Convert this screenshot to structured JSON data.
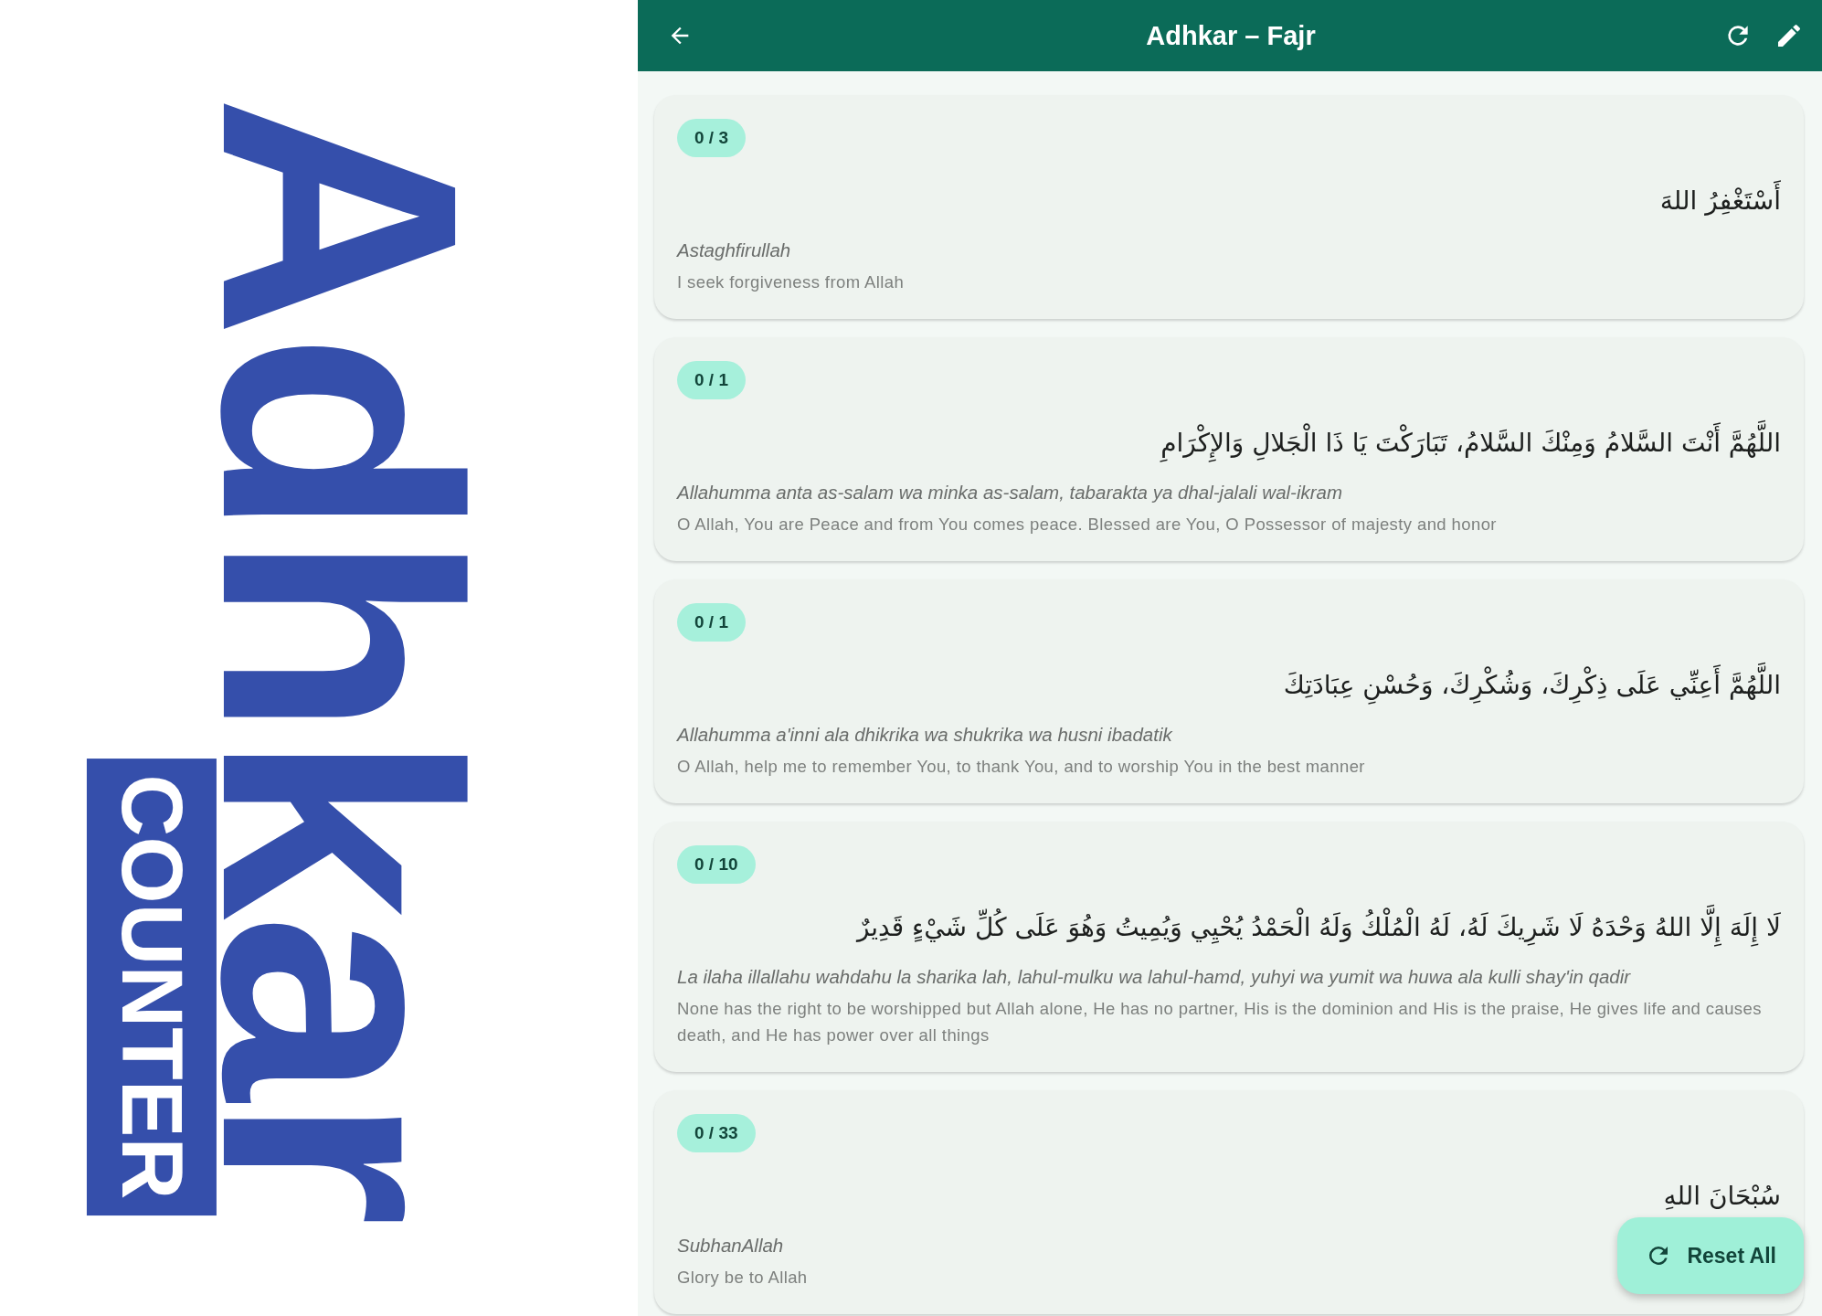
{
  "logo": {
    "title": "Adhkar",
    "subtitle": "COUNTER"
  },
  "app_bar": {
    "title": "Adhkar – Fajr"
  },
  "adhkar": [
    {
      "count": "0 / 3",
      "arabic": "أَسْتَغْفِرُ اللهَ",
      "transliteration": "Astaghfirullah",
      "translation": "I seek forgiveness from Allah"
    },
    {
      "count": "0 / 1",
      "arabic": "اللَّهُمَّ أَنْتَ السَّلامُ وَمِنْكَ السَّلامُ، تَبَارَكْتَ يَا ذَا الْجَلالِ وَالإِكْرَامِ",
      "transliteration": "Allahumma anta as-salam wa minka as-salam, tabarakta ya dhal-jalali wal-ikram",
      "translation": "O Allah, You are Peace and from You comes peace. Blessed are You, O Possessor of majesty and honor"
    },
    {
      "count": "0 / 1",
      "arabic": "اللَّهُمَّ أَعِنِّي عَلَى ذِكْرِكَ، وَشُكْرِكَ، وَحُسْنِ عِبَادَتِكَ",
      "transliteration": "Allahumma a'inni ala dhikrika wa shukrika wa husni ibadatik",
      "translation": "O Allah, help me to remember You, to thank You, and to worship You in the best manner"
    },
    {
      "count": "0 / 10",
      "arabic": "لَا إِلَهَ إِلَّا اللهُ وَحْدَهُ لَا شَرِيكَ لَهُ، لَهُ الْمُلْكُ وَلَهُ الْحَمْدُ يُحْيِي وَيُمِيتُ وَهُوَ عَلَى كُلِّ شَيْءٍ قَدِيرٌ",
      "transliteration": "La ilaha illallahu wahdahu la sharika lah, lahul-mulku wa lahul-hamd, yuhyi wa yumit wa huwa ala kulli shay'in qadir",
      "translation": "None has the right to be worshipped but Allah alone, He has no partner, His is the dominion and His is the praise, He gives life and causes death, and He has power over all things"
    },
    {
      "count": "0 / 33",
      "arabic": "سُبْحَانَ اللهِ",
      "transliteration": "SubhanAllah",
      "translation": "Glory be to Allah"
    }
  ],
  "fab": {
    "label": "Reset All"
  }
}
